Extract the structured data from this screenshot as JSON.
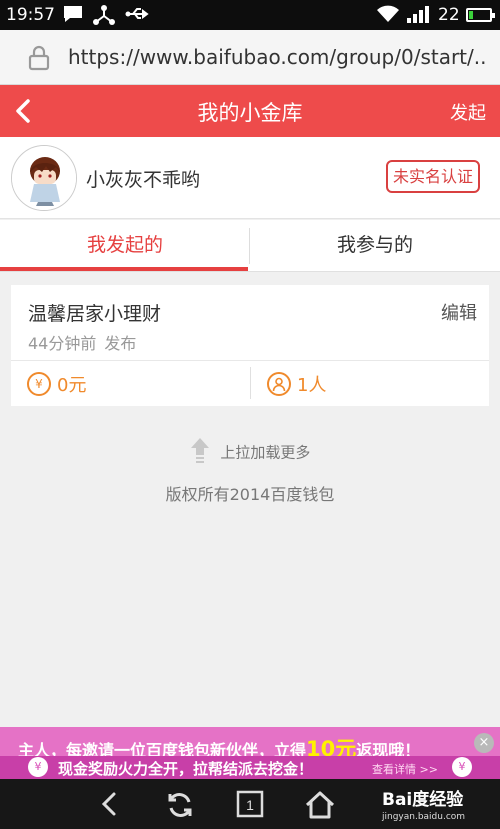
{
  "status_bar": {
    "time": "19:57",
    "battery_percent": "22",
    "battery_level": 0.22,
    "icons": [
      "message-icon",
      "usb-share-icon",
      "usb-icon",
      "wifi-icon",
      "signal-icon",
      "battery-icon"
    ]
  },
  "browser": {
    "url": "https://www.baifubao.com/group/0/start/.."
  },
  "header": {
    "title": "我的小金库",
    "action_label": "发起"
  },
  "profile": {
    "username": "小灰灰不乖哟",
    "verify_badge": "未实名认证"
  },
  "tabs": [
    {
      "label": "我发起的",
      "active": true
    },
    {
      "label": "我参与的",
      "active": false
    }
  ],
  "plan": {
    "name": "温馨居家小理财",
    "edit_label": "编辑",
    "time_ago": "44分钟前",
    "status": "发布",
    "amount": "0元",
    "amount_icon": "¥",
    "participants": "1人"
  },
  "footer": {
    "load_more": "上拉加载更多",
    "copyright": "版权所有2014百度钱包"
  },
  "banner": {
    "line1_prefix": "主人，每邀请一位百度钱包新伙伴，立得",
    "line1_amount": "10元",
    "line1_suffix": "返现哦！",
    "line2": "现金奖励火力全开，拉帮结派去挖金！",
    "details": "查看详情 >>",
    "coin_symbol": "¥",
    "close_symbol": "×"
  },
  "nav": {
    "tab_count": "1",
    "watermark": "Bai度经验",
    "watermark_sub": "jingyan.baidu.com"
  },
  "colors": {
    "accent_red": "#ee4b4b",
    "orange": "#f08a2c",
    "banner_pink": "#e572c6"
  }
}
